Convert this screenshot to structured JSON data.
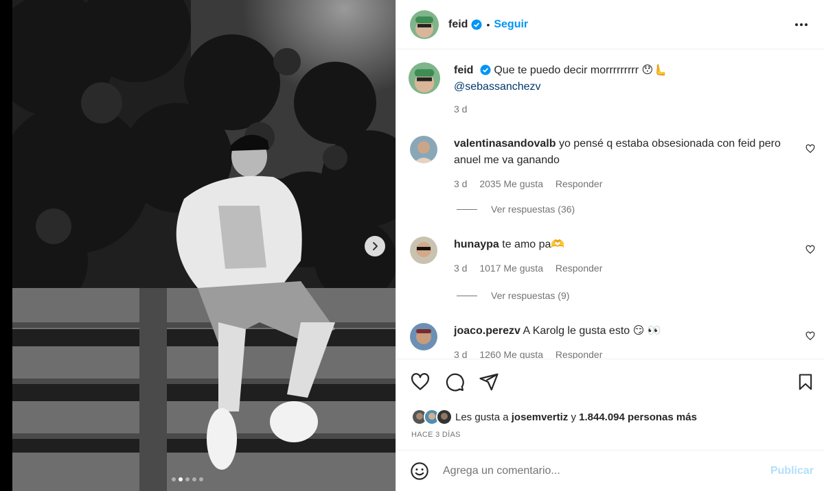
{
  "post": {
    "username": "feid",
    "follow_label": "Seguir",
    "separator": "•",
    "images_total": 5,
    "image_active_index": 1
  },
  "caption": {
    "username": "feid",
    "text": "Que te puedo decir morrrrrrrrr 😯🫷",
    "mention": "@sebassanchezv",
    "time": "3 d"
  },
  "comments": [
    {
      "username": "valentinasandovalb",
      "text": "yo pensé q estaba obsesionada con feid pero anuel me va ganando",
      "time": "3 d",
      "likes": "2035 Me gusta",
      "reply_label": "Responder",
      "view_replies": "Ver respuestas (36)"
    },
    {
      "username": "hunaypa",
      "text": "te amo pa🫶",
      "time": "3 d",
      "likes": "1017 Me gusta",
      "reply_label": "Responder",
      "view_replies": "Ver respuestas (9)"
    },
    {
      "username": "joaco.perezv",
      "text": "A Karolg le gusta esto 😏 👀",
      "time": "3 d",
      "likes": "1260 Me gusta",
      "reply_label": "Responder"
    }
  ],
  "likes": {
    "prefix": "Les gusta a",
    "user": "josemvertiz",
    "connector": "y",
    "count": "1.844.094 personas más"
  },
  "posted_ago": "HACE 3 DÍAS",
  "add_comment": {
    "placeholder": "Agrega un comentario...",
    "publish_label": "Publicar"
  },
  "colors": {
    "accent": "#0095f6",
    "publish_disabled": "#b2dffc",
    "mention": "#00376b",
    "muted": "#737373"
  },
  "icons": [
    "verified-badge-icon",
    "more-options-icon",
    "heart-icon",
    "comment-icon",
    "share-icon",
    "bookmark-icon",
    "emoji-icon",
    "chevron-right-icon"
  ]
}
